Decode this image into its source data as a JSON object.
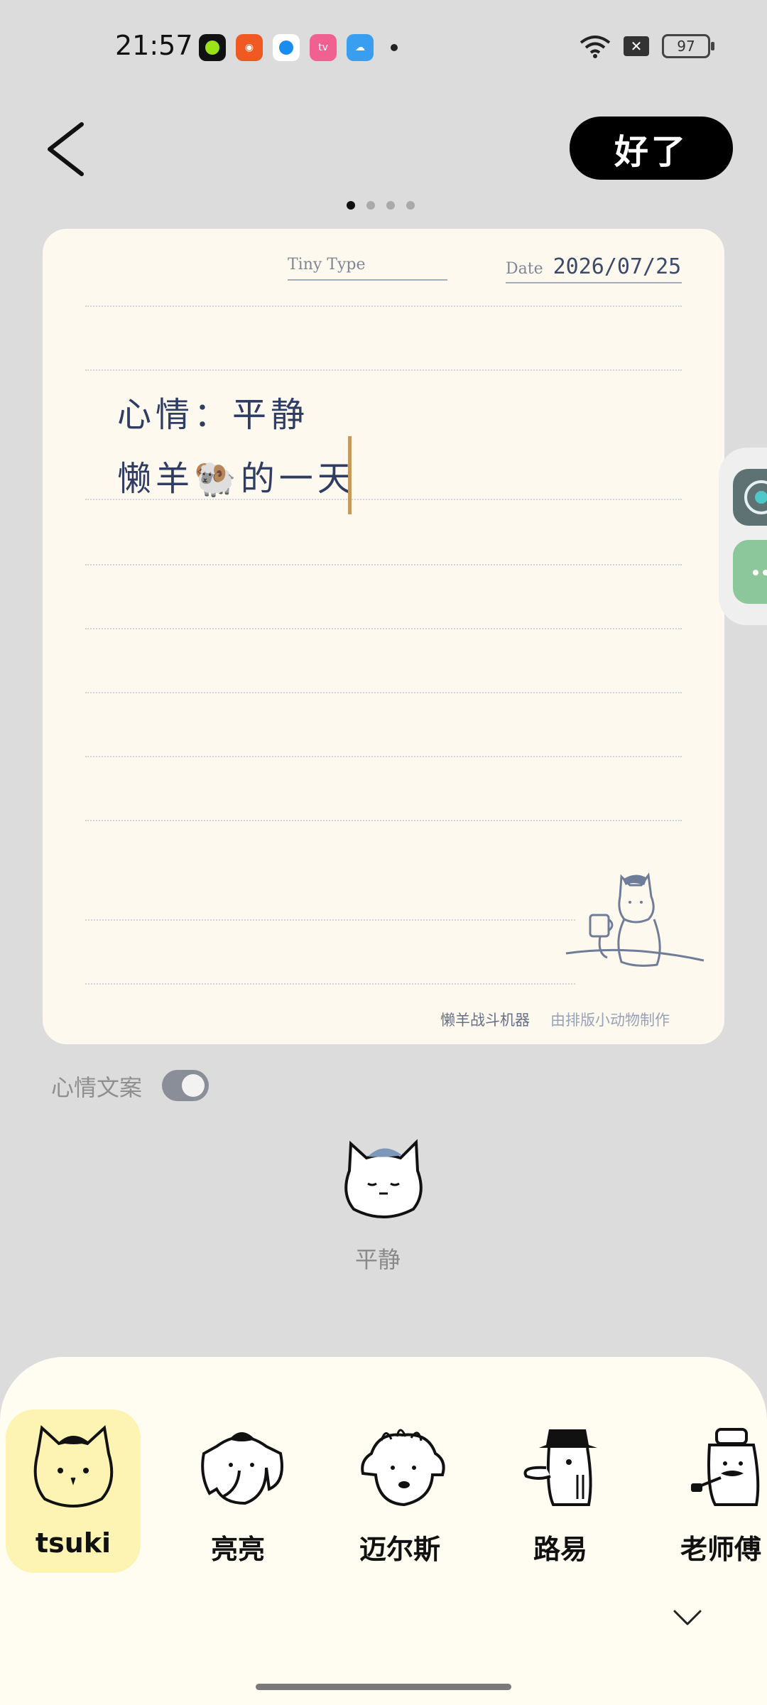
{
  "status_bar": {
    "time": "21:57",
    "battery": "97",
    "apps": [
      {
        "icon": "lime-app-icon",
        "color": "#111111"
      },
      {
        "icon": "kuaishou-icon",
        "color": "#f05a22"
      },
      {
        "icon": "browser-icon",
        "color": "#ffffff"
      },
      {
        "icon": "bilibili-icon",
        "color": "#f06191"
      },
      {
        "icon": "weather-icon",
        "color": "#3a9ef0"
      }
    ]
  },
  "toolbar": {
    "done_label": "好了"
  },
  "pager": {
    "total": 4,
    "active": 1
  },
  "card": {
    "tiny_type_label": "Tiny Type",
    "date_label": "Date",
    "date_value": "2026/07/25",
    "line1": "心情：平静",
    "line2": "懒羊🐏的一天",
    "footer_left": "懒羊战斗机器",
    "footer_right": "由排版小动物制作"
  },
  "mood_toggle": {
    "label": "心情文案",
    "on": true
  },
  "mood": {
    "label": "平静"
  },
  "characters": [
    {
      "name": "tsuki",
      "selected": true
    },
    {
      "name": "亮亮",
      "selected": false
    },
    {
      "name": "迈尔斯",
      "selected": false
    },
    {
      "name": "路易",
      "selected": false
    },
    {
      "name": "老师傅",
      "selected": false
    }
  ],
  "colors": {
    "accent_black": "#000000",
    "card_bg": "#fdf9ef",
    "text_ink": "#2f3c63",
    "selected_char_bg": "#fdf3b3"
  }
}
